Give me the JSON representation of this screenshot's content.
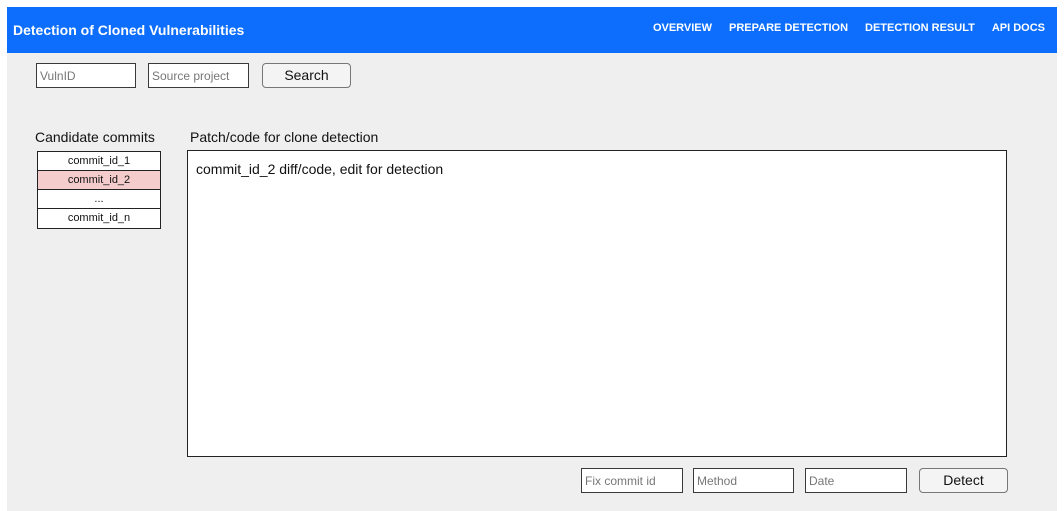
{
  "app": {
    "title": "Detection of Cloned Vulnerabilities"
  },
  "nav": {
    "items": [
      {
        "label": "OVERVIEW"
      },
      {
        "label": "PREPARE DETECTION"
      },
      {
        "label": "DETECTION RESULT"
      },
      {
        "label": "API DOCS"
      }
    ]
  },
  "search": {
    "vuln_id_placeholder": "VulnID",
    "source_project_placeholder": "Source project",
    "button_label": "Search"
  },
  "candidates": {
    "label": "Candidate commits",
    "items": [
      {
        "label": "commit_id_1",
        "selected": false
      },
      {
        "label": "commit_id_2",
        "selected": true
      },
      {
        "label": "...",
        "selected": false
      },
      {
        "label": "commit_id_n",
        "selected": false
      }
    ]
  },
  "patch": {
    "label": "Patch/code for clone detection",
    "content": "commit_id_2 diff/code, edit for detection"
  },
  "detect": {
    "fix_commit_placeholder": "Fix commit id",
    "method_placeholder": "Method",
    "date_placeholder": "Date",
    "button_label": "Detect"
  },
  "colors": {
    "header": "#0d6efd",
    "selected_row": "#f4cccc",
    "background": "#efefef"
  }
}
